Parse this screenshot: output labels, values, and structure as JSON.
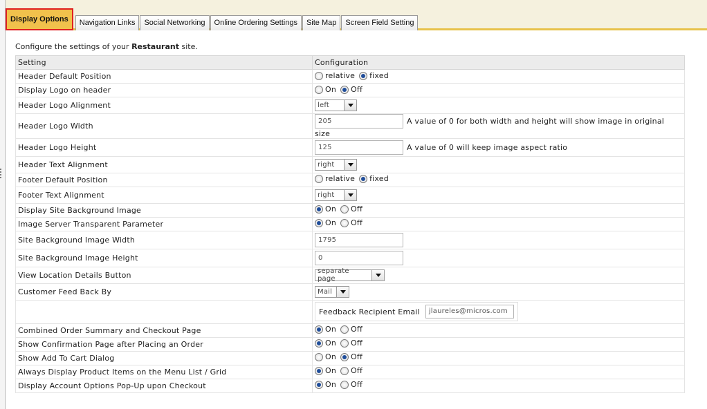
{
  "tabs": [
    {
      "label": "Display Options",
      "active": true
    },
    {
      "label": "Navigation Links"
    },
    {
      "label": "Social Networking"
    },
    {
      "label": "Online Ordering Settings"
    },
    {
      "label": "Site Map"
    },
    {
      "label": "Screen Field Setting"
    }
  ],
  "intro": {
    "prefix": "Configure the settings of your ",
    "site_name": "Restaurant",
    "suffix": " site."
  },
  "table": {
    "col_setting": "Setting",
    "col_configuration": "Configuration"
  },
  "rows": {
    "header_default_position": {
      "label": "Header Default Position",
      "opt1": "relative",
      "opt2": "fixed",
      "selected": "fixed"
    },
    "display_logo_on_header": {
      "label": "Display Logo on header",
      "opt1": "On",
      "opt2": "Off",
      "selected": "Off"
    },
    "header_logo_alignment": {
      "label": "Header Logo Alignment",
      "value": "left"
    },
    "header_logo_width": {
      "label": "Header Logo Width",
      "value": "205",
      "hint": "A value of 0 for both width and height will show image in original size"
    },
    "header_logo_height": {
      "label": "Header Logo Height",
      "value": "125",
      "hint": "A value of 0 will keep image aspect ratio"
    },
    "header_text_alignment": {
      "label": "Header Text Alignment",
      "value": "right"
    },
    "footer_default_position": {
      "label": "Footer Default Position",
      "opt1": "relative",
      "opt2": "fixed",
      "selected": "fixed"
    },
    "footer_text_alignment": {
      "label": "Footer Text Alignment",
      "value": "right"
    },
    "display_site_background_image": {
      "label": "Display Site Background Image",
      "opt1": "On",
      "opt2": "Off",
      "selected": "On"
    },
    "image_server_transparent_parameter": {
      "label": "Image Server Transparent Parameter",
      "opt1": "On",
      "opt2": "Off",
      "selected": "On"
    },
    "site_background_image_width": {
      "label": "Site Background Image Width",
      "value": "1795"
    },
    "site_background_image_height": {
      "label": "Site Background Image Height",
      "value": "0"
    },
    "view_location_details_button": {
      "label": "View Location Details Button",
      "value": "separate page"
    },
    "customer_feed_back_by": {
      "label": "Customer Feed Back By",
      "value": "Mail"
    },
    "feedback_recipient_email": {
      "label": "Feedback Recipient Email",
      "value": "jlaureles@micros.com"
    },
    "combined_order_summary": {
      "label": "Combined Order Summary and Checkout Page",
      "opt1": "On",
      "opt2": "Off",
      "selected": "On"
    },
    "show_confirmation_page": {
      "label": "Show Confirmation Page after Placing an Order",
      "opt1": "On",
      "opt2": "Off",
      "selected": "On"
    },
    "show_add_to_cart_dialog": {
      "label": "Show Add To Cart Dialog",
      "opt1": "On",
      "opt2": "Off",
      "selected": "Off"
    },
    "always_display_product_items": {
      "label": "Always Display Product Items on the Menu List / Grid",
      "opt1": "On",
      "opt2": "Off",
      "selected": "On"
    },
    "display_account_options_popup": {
      "label": "Display Account Options Pop-Up upon Checkout",
      "opt1": "On",
      "opt2": "Off",
      "selected": "On"
    }
  }
}
